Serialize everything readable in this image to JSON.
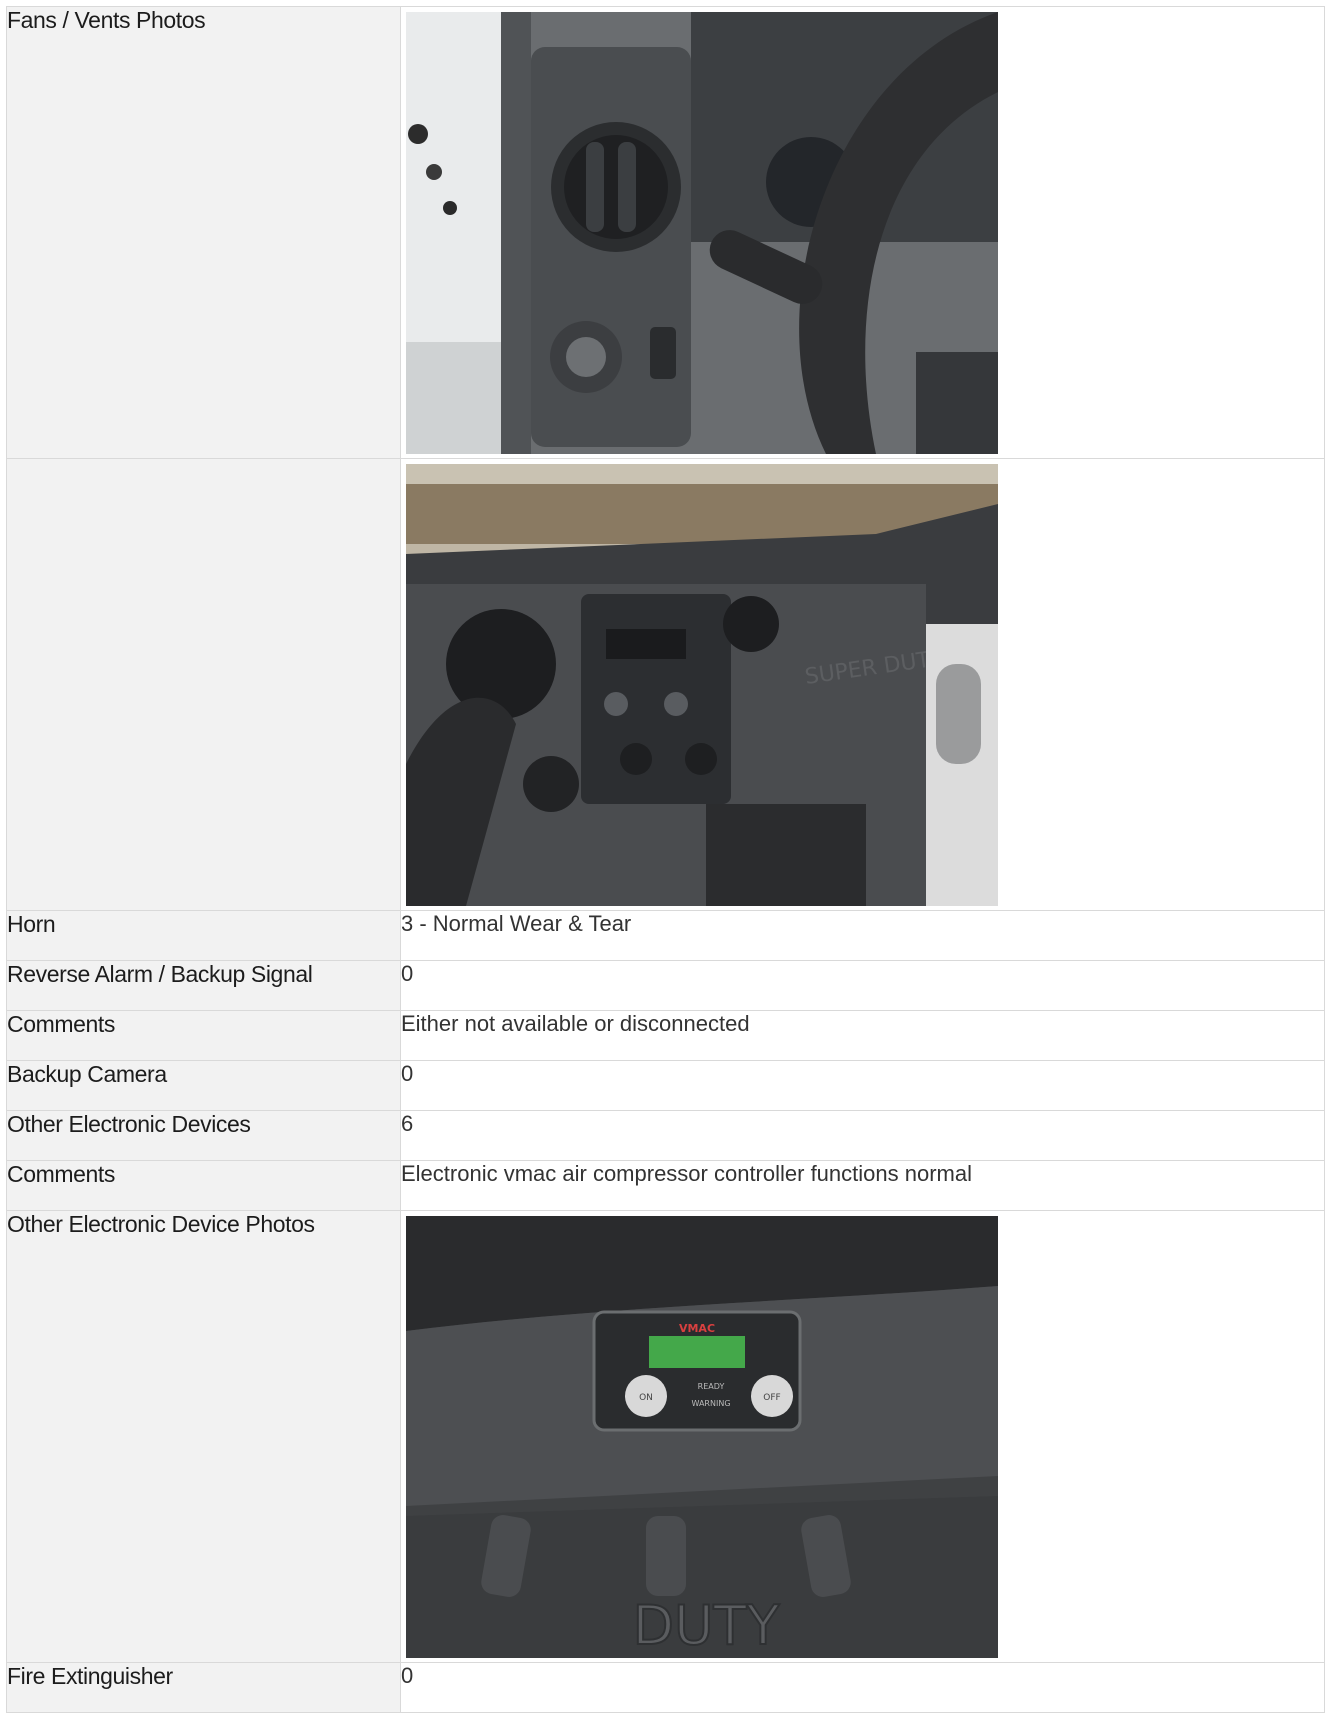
{
  "rows": [
    {
      "label": "Fans / Vents Photos",
      "type": "photo",
      "photo": "dashboard-vent-photo"
    },
    {
      "label": "",
      "type": "photo",
      "photo": "center-console-photo"
    },
    {
      "label": "Horn",
      "value": "3 - Normal Wear & Tear"
    },
    {
      "label": "Reverse Alarm / Backup Signal",
      "value": "0"
    },
    {
      "label": "Comments",
      "value": "Either not available or disconnected"
    },
    {
      "label": "Backup Camera",
      "value": "0"
    },
    {
      "label": "Other Electronic Devices",
      "value": "6"
    },
    {
      "label": "Comments",
      "value": "Electronic vmac air compressor controller functions normal"
    },
    {
      "label": "Other Electronic Device Photos",
      "type": "photo",
      "photo": "vmac-controller-photo"
    },
    {
      "label": "Fire Extinguisher",
      "value": "0"
    }
  ],
  "photo_text": {
    "controller_brand": "VMAC",
    "btn_on": "ON",
    "btn_off": "OFF",
    "ready": "READY",
    "warning": "WARNING",
    "duty": "DUTY",
    "super_duty": "SUPER DUTY"
  }
}
